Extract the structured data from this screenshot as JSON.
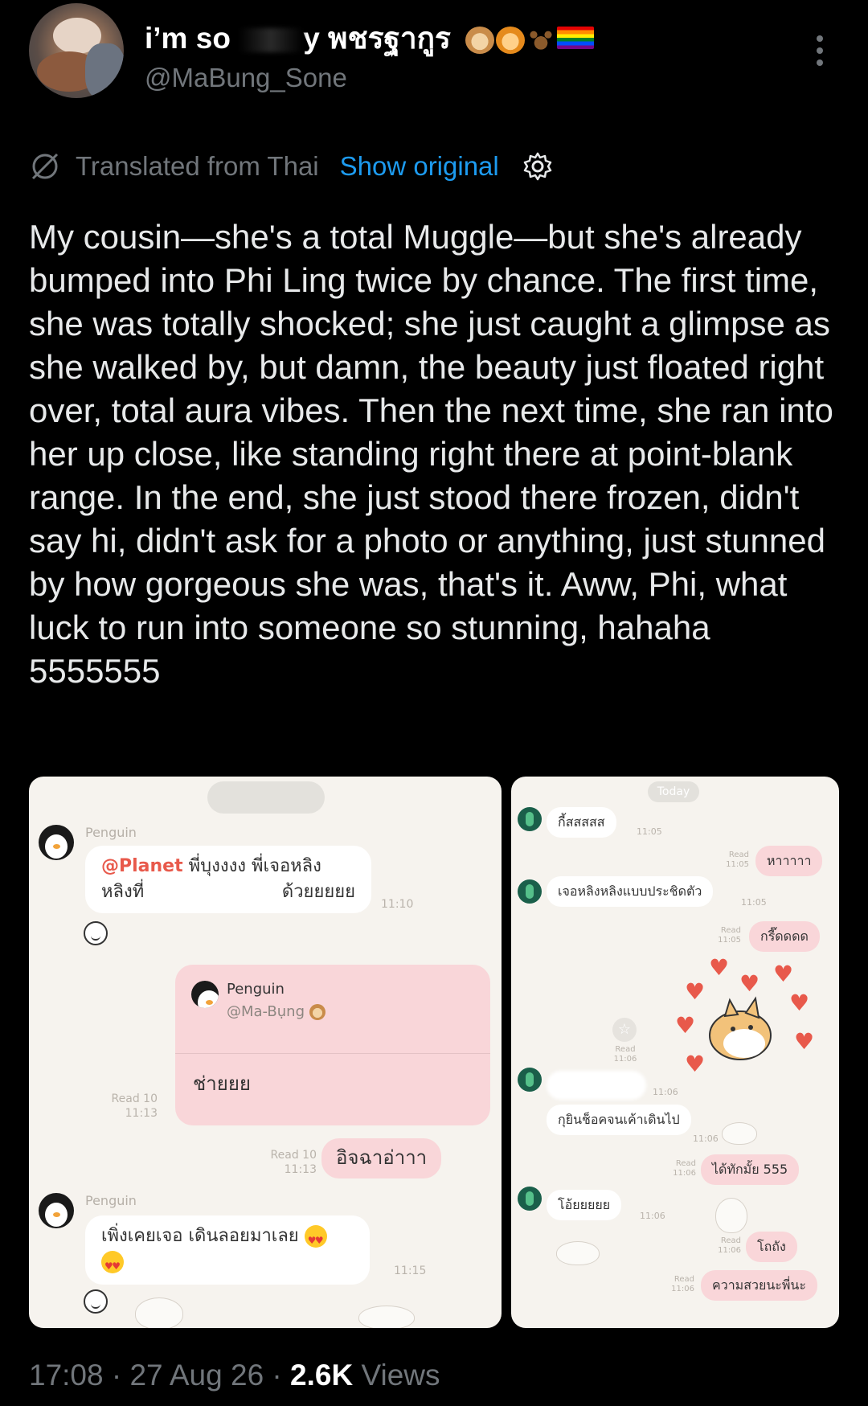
{
  "author": {
    "display_name_prefix": "i’m so",
    "display_name_suffix": "y พชรฐากูร",
    "handle": "@MaBung_Sone",
    "name_emojis": [
      "dog-face",
      "tiger-face",
      "paw-prints",
      "rainbow-flag"
    ]
  },
  "translation": {
    "label": "Translated from Thai",
    "show_original": "Show original",
    "accent_color": "#1d9bf0"
  },
  "tweet": {
    "text": "My cousin—she's a total Muggle—but she's already bumped into Phi Ling twice by chance. The first time, she was totally shocked; she just caught a glimpse as she walked by, but damn, the beauty just floated right over, total aura vibes. Then the next time, she ran into her up close, like standing right there at point-blank range. In the end, she just stood there frozen, didn't say hi, didn't ask for a photo or anything, just stunned by how gorgeous she was, that's it. Aww, Phi, what luck to run into someone so stunning, hahaha 5555555"
  },
  "chat_left": {
    "msg1": {
      "sender": "Penguin",
      "mention": "@Planet",
      "line1_rest": " พี่บุงงงง พี่เจอหลิง",
      "line2_left": "หลิงที่",
      "line2_right": "ด้วยยยยย",
      "time": "11:10"
    },
    "card": {
      "name": "Penguin",
      "handle": "@Ma-Bụng",
      "body": "ช่ายยย",
      "read": "Read 10",
      "time": "11:13"
    },
    "msg3": {
      "text": "อิจฉาอ่าาา",
      "read": "Read 10",
      "time": "11:13"
    },
    "msg4": {
      "sender": "Penguin",
      "text": "เพิ่งเคยเจอ เดินลอยมาเลย",
      "time": "11:15"
    }
  },
  "chat_right": {
    "today": "Today",
    "m1": {
      "text": "กี้สสสสส",
      "time": "11:05"
    },
    "m2": {
      "text": "หาาาาา",
      "read": "Read",
      "time": "11:05"
    },
    "m3": {
      "text": "เจอหลิงหลิงแบบประชิดตัว",
      "time": "11:05"
    },
    "m4": {
      "text": "กรี๊ดดดด",
      "read": "Read",
      "time": "11:05"
    },
    "sticker": {
      "read": "Read",
      "time": "11:06"
    },
    "m5": {
      "time": "11:06"
    },
    "m6": {
      "text": "กุยินช็อคจนเค้าเดินไป",
      "time": "11:06"
    },
    "m7": {
      "text": "ได้ทักมั้ย 555",
      "read": "Read",
      "time": "11:06"
    },
    "m8": {
      "text": "โอ้ยยยยย",
      "time": "11:06"
    },
    "m9": {
      "text": "โถถัง",
      "read": "Read",
      "time": "11:06"
    },
    "m10": {
      "text": "ความสวยนะพี่นะ",
      "read": "Read",
      "time": "11:06"
    }
  },
  "meta": {
    "time": "17:08",
    "date": "27 Aug 26",
    "views_count": "2.6K",
    "views_label": "Views"
  }
}
